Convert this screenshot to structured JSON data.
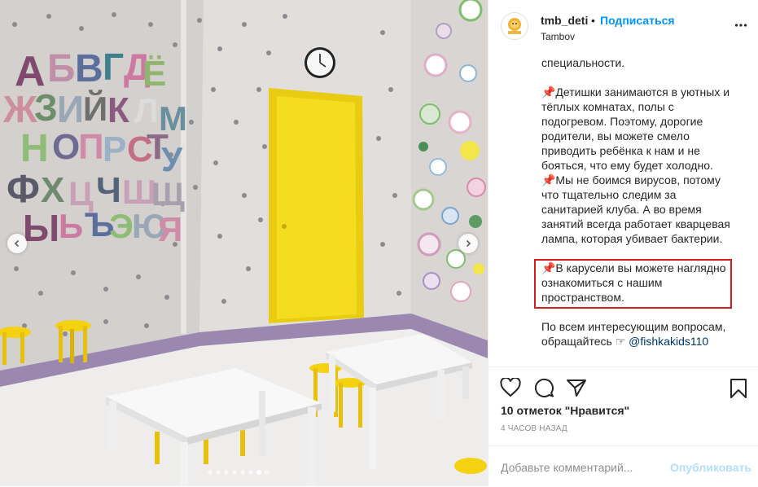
{
  "post": {
    "username": "tmb_deti",
    "separator": "•",
    "follow_label": "Подписаться",
    "location": "Tambov",
    "caption": {
      "line0": "специальности.",
      "para1": "📌Детишки занимаются в уютных и\nтёплых комнатах, полы с\nподогревом. Поэтому, дорогие\nродители, вы можете смело\nприводить ребёнка к нам и не\nбояться, что ему будет холодно.\n📌Мы не боимся вирусов, потому\nчто тщательно следим за\nсанитарией клуба. А во время\nзанятий всегда работает кварцевая\nлампа, которая убивает бактерии.",
      "para2": "📌В карусели вы можете наглядно\nознакомиться с нашим\nпространством.",
      "para3_text": "По всем интересующим вопросам,\nобращайтесь ☞ ",
      "para3_mention": "@fishkakids110"
    },
    "likes_text": "10 отметок \"Нравится\"",
    "time_text": "4 ЧАСОВ НАЗАД",
    "comment_placeholder": "Добавьте комментарий...",
    "publish_label": "Опубликовать"
  },
  "carousel": {
    "slide_count": 8,
    "active_index": 6
  },
  "photo": {
    "alphabet_letters": [
      "А",
      "Б",
      "В",
      "Г",
      "Д",
      "Е",
      "Ё",
      "Ж",
      "З",
      "И",
      "Й",
      "К",
      "Л",
      "М",
      "Н",
      "О",
      "П",
      "Р",
      "С",
      "Т",
      "У",
      "Ф",
      "Х",
      "Ц",
      "Ч",
      "Ш",
      "Щ",
      "Ъ",
      "Ы",
      "Ь",
      "Э",
      "Ю",
      "Я"
    ]
  },
  "colors": {
    "accent": "#0095f6",
    "highlight_border": "#d81b1b",
    "door_yellow": "#f4dd1f",
    "stool_yellow": "#f5d20f"
  },
  "icons": {
    "more": "more-icon",
    "like": "heart-icon",
    "comment": "comment-icon",
    "share": "share-icon",
    "save": "bookmark-icon",
    "prev": "chevron-left-icon",
    "next": "chevron-right-icon"
  }
}
